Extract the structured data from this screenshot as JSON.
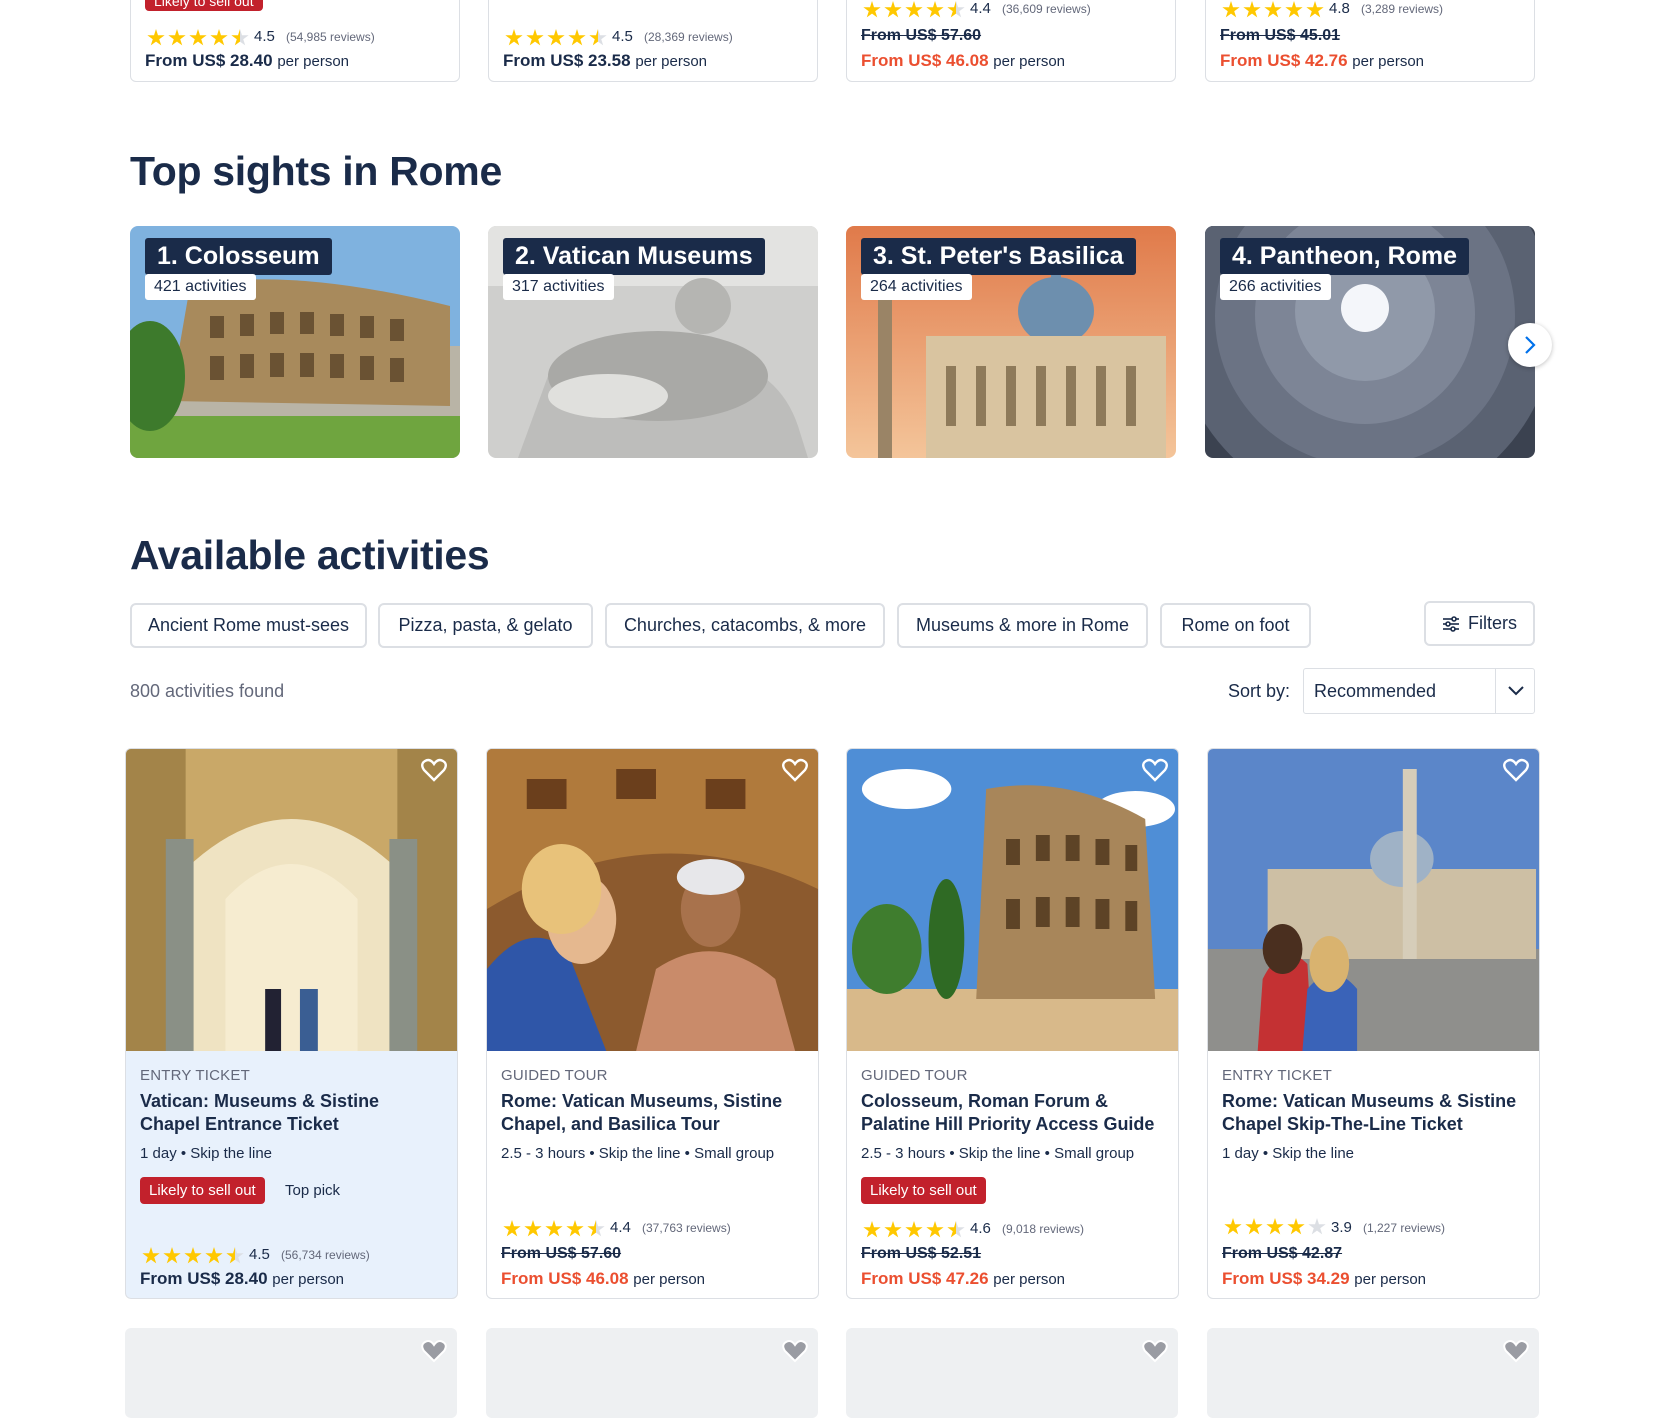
{
  "top_cards": [
    {
      "badge": "Likely to sell out",
      "rating": "4.5",
      "reviews": "(54,985 reviews)",
      "price_prefix": "From",
      "price": "US$ 28.40",
      "per": "per person",
      "stars": [
        1,
        1,
        1,
        1,
        0.5
      ]
    },
    {
      "rating": "4.5",
      "reviews": "(28,369 reviews)",
      "price_prefix": "From",
      "price": "US$ 23.58",
      "per": "per person",
      "stars": [
        1,
        1,
        1,
        1,
        0.5
      ]
    },
    {
      "rating": "4.4",
      "reviews": "(36,609 reviews)",
      "original": "From US$ 57.60",
      "price": "From US$ 46.08",
      "per": "per person",
      "stars": [
        1,
        1,
        1,
        1,
        0.5
      ]
    },
    {
      "rating": "4.8",
      "reviews": "(3,289 reviews)",
      "original": "From US$ 45.01",
      "price": "From US$ 42.76",
      "per": "per person",
      "stars": [
        1,
        1,
        1,
        1,
        1
      ]
    }
  ],
  "sights": {
    "heading": "Top sights in Rome",
    "items": [
      {
        "title": "1. Colosseum",
        "count": "421 activities"
      },
      {
        "title": "2. Vatican Museums",
        "count": "317 activities"
      },
      {
        "title": "3. St. Peter's Basilica",
        "count": "264 activities"
      },
      {
        "title": "4. Pantheon, Rome",
        "count": "266 activities"
      }
    ]
  },
  "activities": {
    "heading": "Available activities",
    "chips": [
      "Ancient Rome must-sees",
      "Pizza, pasta, & gelato",
      "Churches, catacombs, & more",
      "Museums & more in Rome",
      "Rome on foot"
    ],
    "filters_label": "Filters",
    "found": "800 activities found",
    "sort_label": "Sort by:",
    "sort_value": "Recommended",
    "cards": [
      {
        "category": "ENTRY TICKET",
        "title": "Vatican: Museums & Sistine Chapel Entrance Ticket",
        "meta": "1 day • Skip the line",
        "badge": "Likely to sell out",
        "badge2": "Top pick",
        "rating": "4.5",
        "reviews": "(56,734 reviews)",
        "price": "From US$ 28.40",
        "per": "per person",
        "stars": [
          1,
          1,
          1,
          1,
          0.5
        ]
      },
      {
        "category": "GUIDED TOUR",
        "title": "Rome: Vatican Museums, Sistine Chapel, and Basilica Tour",
        "meta": "2.5 - 3 hours • Skip the line • Small group",
        "rating": "4.4",
        "reviews": "(37,763 reviews)",
        "original": "From US$ 57.60",
        "price": "From US$ 46.08",
        "per": "per person",
        "stars": [
          1,
          1,
          1,
          1,
          0.5
        ]
      },
      {
        "category": "GUIDED TOUR",
        "title": "Colosseum, Roman Forum & Palatine Hill Priority Access Guide",
        "meta": "2.5 - 3 hours • Skip the line • Small group",
        "badge": "Likely to sell out",
        "rating": "4.6",
        "reviews": "(9,018 reviews)",
        "original": "From US$ 52.51",
        "price": "From US$ 47.26",
        "per": "per person",
        "stars": [
          1,
          1,
          1,
          1,
          0.5
        ]
      },
      {
        "category": "ENTRY TICKET",
        "title": "Rome: Vatican Museums & Sistine Chapel Skip-The-Line Ticket",
        "meta": "1 day • Skip the line",
        "rating": "3.9",
        "reviews": "(1,227 reviews)",
        "original": "From US$ 42.87",
        "price": "From US$ 34.29",
        "per": "per person",
        "stars": [
          1,
          1,
          1,
          1,
          0
        ]
      }
    ]
  },
  "colors": {
    "navy": "#1a2b49",
    "sale": "#eb4f30",
    "badge_red": "#c2212c",
    "star": "#ffc800",
    "highlight_card": "#e8f1fc"
  },
  "icons": [
    "heart-icon",
    "star-icon",
    "chevron-right-icon",
    "chevron-down-icon",
    "filter-icon"
  ]
}
